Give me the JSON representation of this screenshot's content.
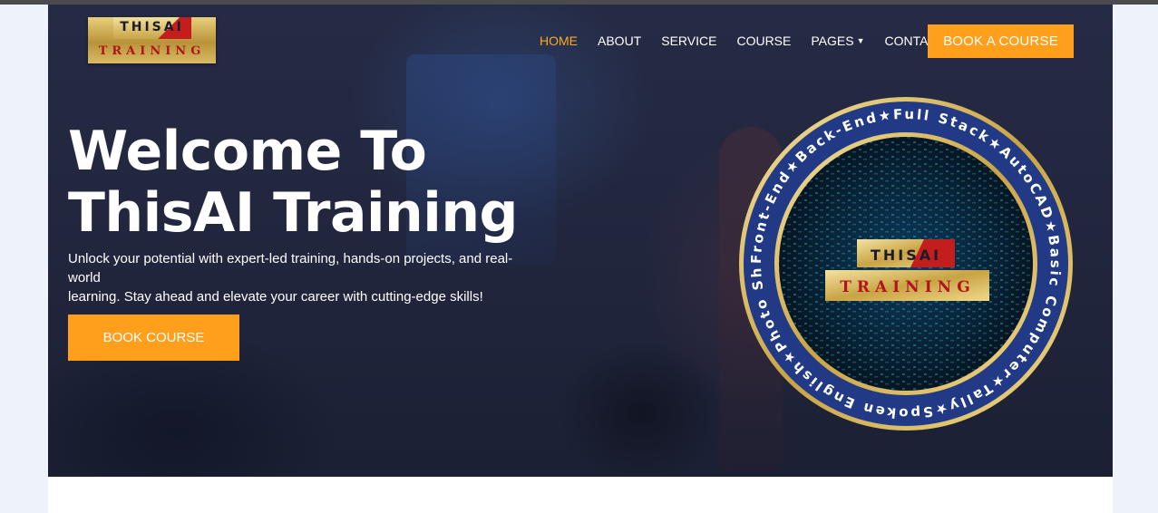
{
  "logo": {
    "line1": "THISAI",
    "line2": "TRAINING"
  },
  "nav": {
    "items": [
      {
        "label": "HOME",
        "active": true
      },
      {
        "label": "ABOUT",
        "active": false
      },
      {
        "label": "SERVICE",
        "active": false
      },
      {
        "label": "COURSE",
        "active": false
      },
      {
        "label": "PAGES",
        "active": false,
        "dropdown": true
      },
      {
        "label": "CONTACT",
        "active": false
      }
    ],
    "cta_label": "BOOK A COURSE"
  },
  "hero": {
    "title_line1": "Welcome To",
    "title_line2": "ThisAI Training",
    "subtitle_line1": "Unlock your potential with expert-led training, hands-on projects, and real-world",
    "subtitle_line2": "learning. Stay ahead and elevate your career with cutting-edge skills!",
    "button_label": "BOOK COURSE"
  },
  "badge": {
    "ring_text": "Front-End★Back-End★Full Stack★AutoCAD★Basic Computer★Tally★Spoken English★Photo Shop★",
    "center_line1": "THISAI",
    "center_line2": "TRAINING"
  },
  "colors": {
    "accent": "#ff9f1c",
    "active_nav": "#ffa91f",
    "badge_ring": "#223a86",
    "badge_gold": "#d9b552",
    "logo_red": "#c41d1d"
  },
  "icons": {
    "dropdown": "caret-down-icon"
  }
}
